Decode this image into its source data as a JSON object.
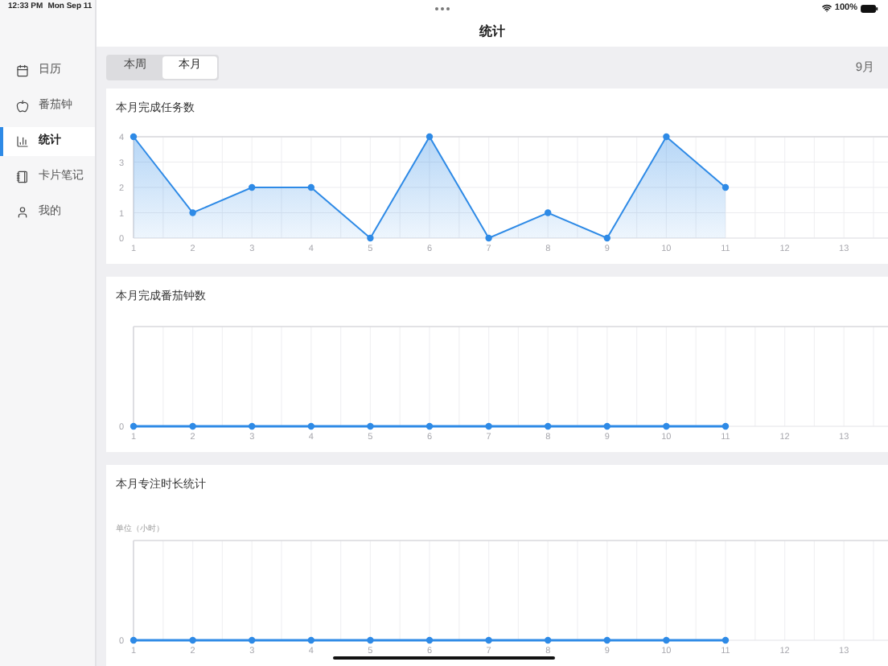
{
  "status_bar": {
    "time": "12:33 PM",
    "date": "Mon Sep 11",
    "battery": "100%"
  },
  "sidebar": {
    "items": [
      {
        "label": "日历",
        "selected": false
      },
      {
        "label": "番茄钟",
        "selected": false
      },
      {
        "label": "统计",
        "selected": true
      },
      {
        "label": "卡片笔记",
        "selected": false
      },
      {
        "label": "我的",
        "selected": false
      }
    ]
  },
  "header": {
    "title": "统计"
  },
  "tabs": [
    {
      "label": "本周",
      "selected": false
    },
    {
      "label": "本月",
      "selected": true
    }
  ],
  "period": "9月",
  "cards": [
    {
      "chart_data": {
        "type": "area",
        "title": "本月完成任务数",
        "categories": [
          "1",
          "2",
          "3",
          "4",
          "5",
          "6",
          "7",
          "8",
          "9",
          "10",
          "11",
          "12",
          "13"
        ],
        "ylim": [
          0,
          4
        ],
        "yticks": [
          0,
          1,
          2,
          3,
          4
        ],
        "grid": true,
        "series": [
          {
            "color": "#2e8ae6",
            "values": [
              4,
              1,
              2,
              2,
              0,
              4,
              0,
              1,
              0,
              4,
              2,
              null,
              null
            ]
          }
        ]
      }
    },
    {
      "title": "本月完成番茄钟数",
      "y_labels": [
        "0"
      ],
      "x_labels": [
        "1",
        "2",
        "3",
        "4",
        "5",
        "6",
        "7",
        "8",
        "9",
        "10",
        "11",
        "12",
        "13"
      ]
    },
    {
      "title": "本月专注时长统计",
      "unit_label": "单位（小时）",
      "y_labels": [
        "0"
      ],
      "x_labels": [
        "1",
        "2",
        "3",
        "4",
        "5",
        "6",
        "7",
        "8",
        "9",
        "10",
        "11",
        "12",
        "13"
      ]
    }
  ]
}
